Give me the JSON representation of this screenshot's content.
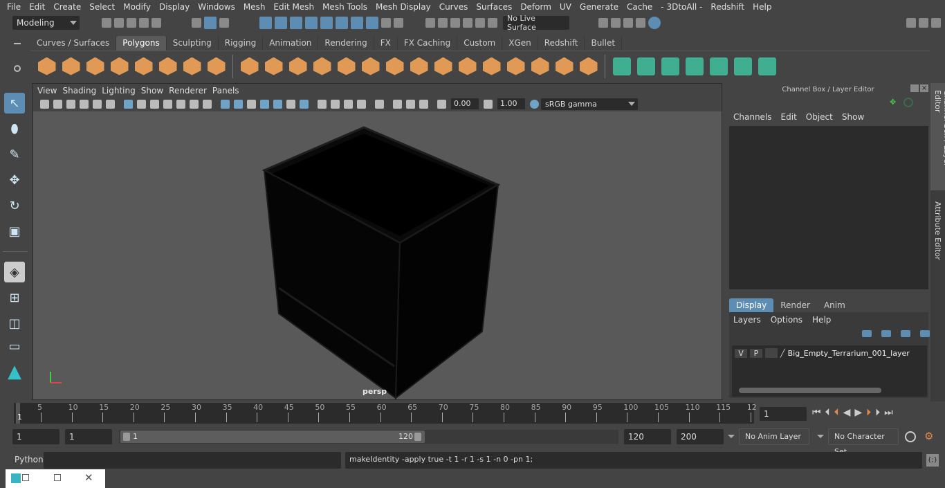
{
  "menubar": [
    "File",
    "Edit",
    "Create",
    "Select",
    "Modify",
    "Display",
    "Windows",
    "Mesh",
    "Edit Mesh",
    "Mesh Tools",
    "Mesh Display",
    "Curves",
    "Surfaces",
    "Deform",
    "UV",
    "Generate",
    "Cache",
    "- 3DtoAll -",
    "Redshift",
    "Help"
  ],
  "toolbar": {
    "mode": "Modeling",
    "live_surface": "No Live Surface"
  },
  "shelf": {
    "tabs": [
      "Curves / Surfaces",
      "Polygons",
      "Sculpting",
      "Rigging",
      "Animation",
      "Rendering",
      "FX",
      "FX Caching",
      "Custom",
      "XGen",
      "Redshift",
      "Bullet"
    ],
    "active_tab": "Polygons",
    "icons": [
      "sphere",
      "cube",
      "cylinder",
      "cone",
      "plane",
      "torus",
      "pyramid",
      "pipe",
      "|",
      "combine",
      "separate",
      "extract",
      "smooth",
      "mirror",
      "boolean",
      "multi-cut",
      "bridge",
      "extrude",
      "bevel",
      "append",
      "fill-hole",
      "insert-edge-loop",
      "split",
      "merge",
      "|",
      "uv-planar",
      "uv-cylindrical",
      "uv-spherical",
      "uv-auto",
      "uv-unfold",
      "uv-layout",
      "uv-editor"
    ]
  },
  "viewport": {
    "menu": [
      "View",
      "Shading",
      "Lighting",
      "Show",
      "Renderer",
      "Panels"
    ],
    "exposure": "0.00",
    "gamma": "1.00",
    "color_space": "sRGB gamma",
    "camera_label": "persp",
    "axis": {
      "x": "x",
      "y": "y",
      "z": "z"
    }
  },
  "right_panel": {
    "title": "Channel Box / Layer Editor",
    "channel_menu": [
      "Channels",
      "Edit",
      "Object",
      "Show"
    ],
    "layer_tabs": [
      "Display",
      "Render",
      "Anim"
    ],
    "active_layer_tab": "Display",
    "layer_menu": [
      "Layers",
      "Options",
      "Help"
    ],
    "layer": {
      "v": "V",
      "p": "P",
      "name": "Big_Empty_Terrarium_001_layer"
    },
    "side_tabs": [
      "Channel Box / Layer Editor",
      "Attribute Editor"
    ]
  },
  "timeline": {
    "ticks": [
      "5",
      "10",
      "15",
      "20",
      "25",
      "30",
      "35",
      "40",
      "45",
      "50",
      "55",
      "60",
      "65",
      "70",
      "75",
      "80",
      "85",
      "90",
      "95",
      "100",
      "105",
      "110",
      "115",
      "12"
    ],
    "current_marker": "1",
    "current_frame": "1"
  },
  "range": {
    "start": "1",
    "current": "1",
    "slider_start": "1",
    "slider_end": "120",
    "end": "120",
    "max": "200",
    "anim_layer": "No Anim Layer",
    "character_set": "No Character Set"
  },
  "command": {
    "lang": "Python",
    "input": "",
    "output": "makeIdentity -apply true -t 1 -r 1 -s 1 -n 0 -pn 1;"
  },
  "colors": {
    "accent": "#5d8db3",
    "shelf_orange": "#e09a55",
    "background": "#444444",
    "viewport": "#595959"
  }
}
